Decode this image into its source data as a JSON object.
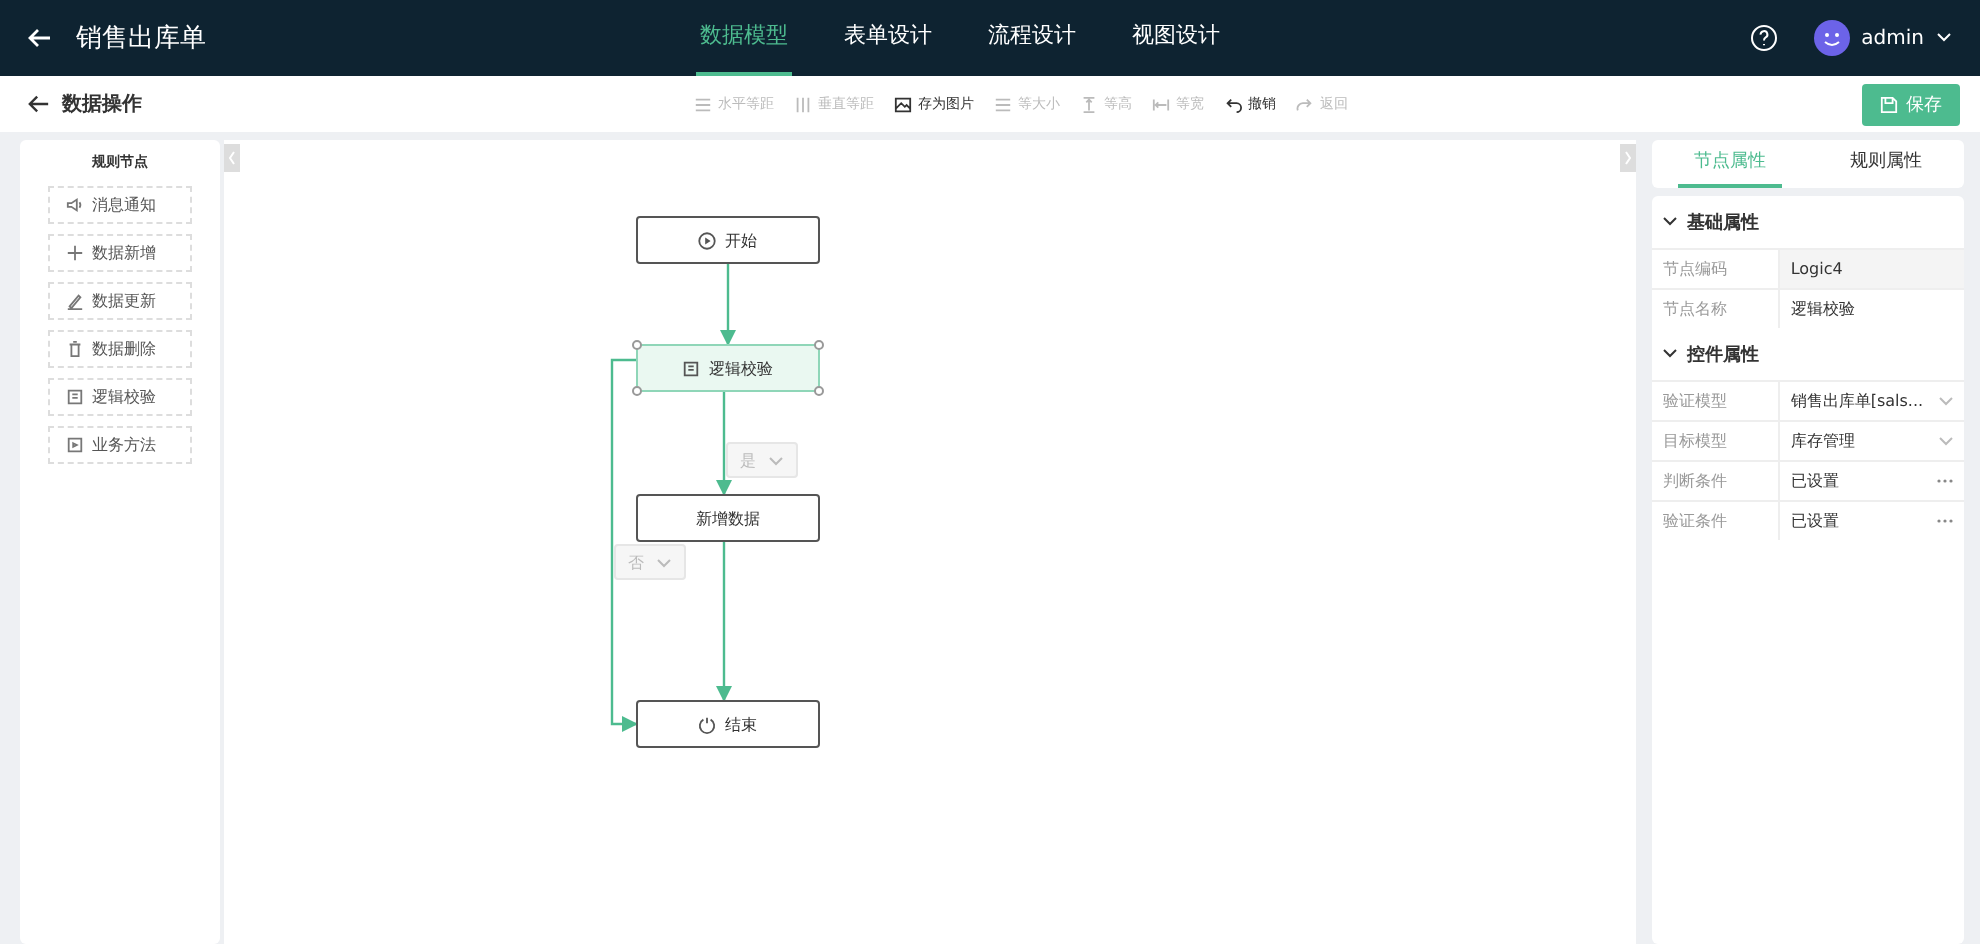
{
  "header": {
    "title": "销售出库单",
    "tabs": [
      {
        "label": "数据模型",
        "selected": true
      },
      {
        "label": "表单设计",
        "selected": false
      },
      {
        "label": "流程设计",
        "selected": false
      },
      {
        "label": "视图设计",
        "selected": false
      }
    ],
    "user": "admin"
  },
  "subheader": {
    "title": "数据操作",
    "tools": [
      {
        "label": "水平等距",
        "disabled": true
      },
      {
        "label": "垂直等距",
        "disabled": true
      },
      {
        "label": "存为图片",
        "disabled": false
      },
      {
        "label": "等大小",
        "disabled": true
      },
      {
        "label": "等高",
        "disabled": true
      },
      {
        "label": "等宽",
        "disabled": true
      },
      {
        "label": "撤销",
        "disabled": false
      },
      {
        "label": "返回",
        "disabled": true
      }
    ],
    "save": "保存"
  },
  "palette": {
    "title": "规则节点",
    "items": [
      {
        "label": "消息通知"
      },
      {
        "label": "数据新增"
      },
      {
        "label": "数据更新"
      },
      {
        "label": "数据删除"
      },
      {
        "label": "逻辑校验"
      },
      {
        "label": "业务方法"
      }
    ]
  },
  "canvas": {
    "nodes": [
      {
        "label": "开始",
        "kind": "start",
        "selected": false
      },
      {
        "label": "逻辑校验",
        "kind": "check",
        "selected": true
      },
      {
        "label": "新增数据",
        "kind": "task",
        "selected": false
      },
      {
        "label": "结束",
        "kind": "end",
        "selected": false
      }
    ],
    "branches": [
      {
        "label": "是"
      },
      {
        "label": "否"
      }
    ]
  },
  "properties": {
    "tabs": [
      {
        "label": "节点属性",
        "selected": true
      },
      {
        "label": "规则属性",
        "selected": false
      }
    ],
    "sections": [
      {
        "title": "基础属性",
        "expanded": true,
        "rows": [
          {
            "label": "节点编码",
            "value": "Logic4",
            "kind": "text",
            "disabled": true
          },
          {
            "label": "节点名称",
            "value": "逻辑校验",
            "kind": "text",
            "disabled": false
          }
        ]
      },
      {
        "title": "控件属性",
        "expanded": true,
        "rows": [
          {
            "label": "验证模型",
            "value": "销售出库单[sals...",
            "kind": "select",
            "disabled": false
          },
          {
            "label": "目标模型",
            "value": "库存管理",
            "kind": "select",
            "disabled": false
          },
          {
            "label": "判断条件",
            "value": "已设置",
            "kind": "dialog",
            "disabled": false
          },
          {
            "label": "验证条件",
            "value": "已设置",
            "kind": "dialog",
            "disabled": false
          }
        ]
      }
    ]
  }
}
